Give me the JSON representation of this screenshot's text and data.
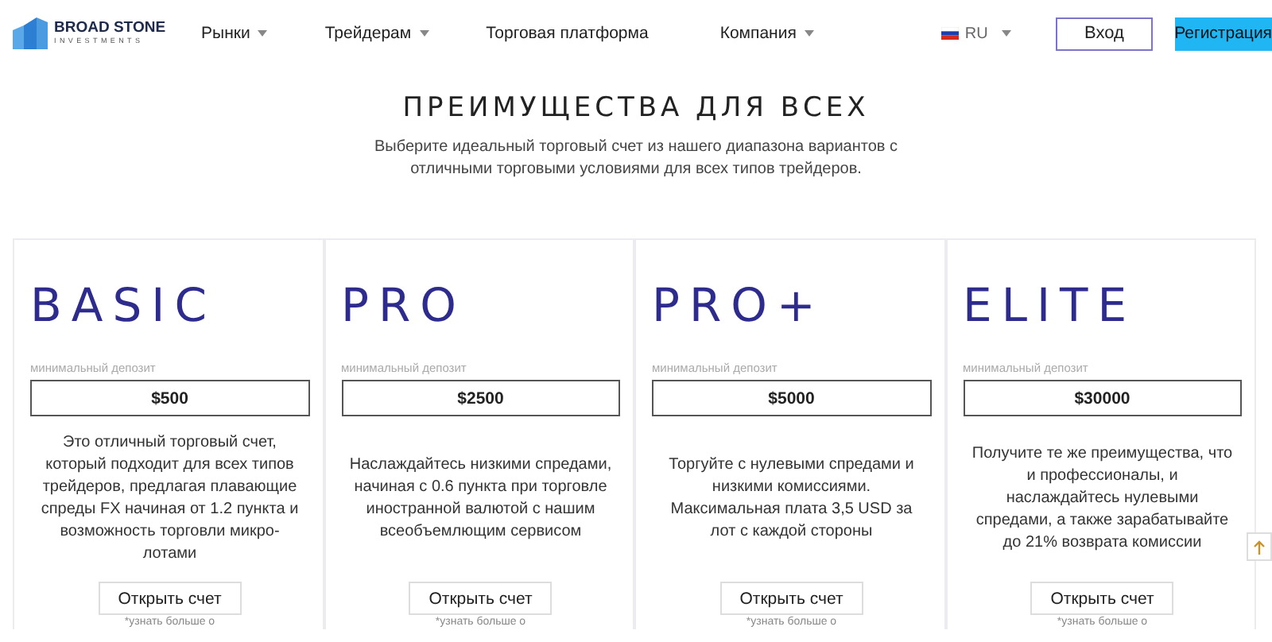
{
  "header": {
    "logo": {
      "name": "BROAD STONE",
      "tagline": "INVESTMENTS"
    },
    "nav": [
      {
        "label": "Рынки",
        "dropdown": true
      },
      {
        "label": "Трейдерам",
        "dropdown": true
      },
      {
        "label": "Торговая платформа",
        "dropdown": false
      },
      {
        "label": "Компания",
        "dropdown": true
      }
    ],
    "language": "RU",
    "login": "Вход",
    "register": "Регистрация"
  },
  "section": {
    "title": "ПРЕИМУЩЕСТВА ДЛЯ ВСЕХ",
    "subtitle": "Выберите идеальный торговый счет из нашего диапазона вариантов с отличными торговыми условиями для всех типов трейдеров."
  },
  "plans": [
    {
      "name": "BASIC",
      "deposit_label": "минимальный депозит",
      "deposit": "$500",
      "description": "Это отличный торговый счет, который подходит для всех типов трейдеров, предлагая плавающие спреды FX начиная от 1.2 пункта и возможность торговли микро-лотами",
      "button": "Открыть счет",
      "footnote": "*узнать больше о"
    },
    {
      "name": "PRO",
      "deposit_label": "минимальный депозит",
      "deposit": "$2500",
      "description": "Наслаждайтесь низкими спредами, начиная с 0.6 пункта при торговле иностранной валютой с нашим всеобъемлющим сервисом",
      "button": "Открыть счет",
      "footnote": "*узнать больше о"
    },
    {
      "name": "PRO+",
      "deposit_label": "минимальный депозит",
      "deposit": "$5000",
      "description": "Торгуйте с нулевыми спредами и низкими комиссиями. Максимальная плата 3,5 USD за лот с каждой стороны",
      "button": "Открыть счет",
      "footnote": "*узнать больше о"
    },
    {
      "name": "ELITE",
      "deposit_label": "минимальный депозит",
      "deposit": "$30000",
      "description": "Получите те же преимущества, что и профессионалы, и наслаждайтесь нулевыми спредами, а также зарабатывайте до 21% возврата комиссии",
      "button": "Открыть счет",
      "footnote": "*узнать больше о"
    }
  ]
}
